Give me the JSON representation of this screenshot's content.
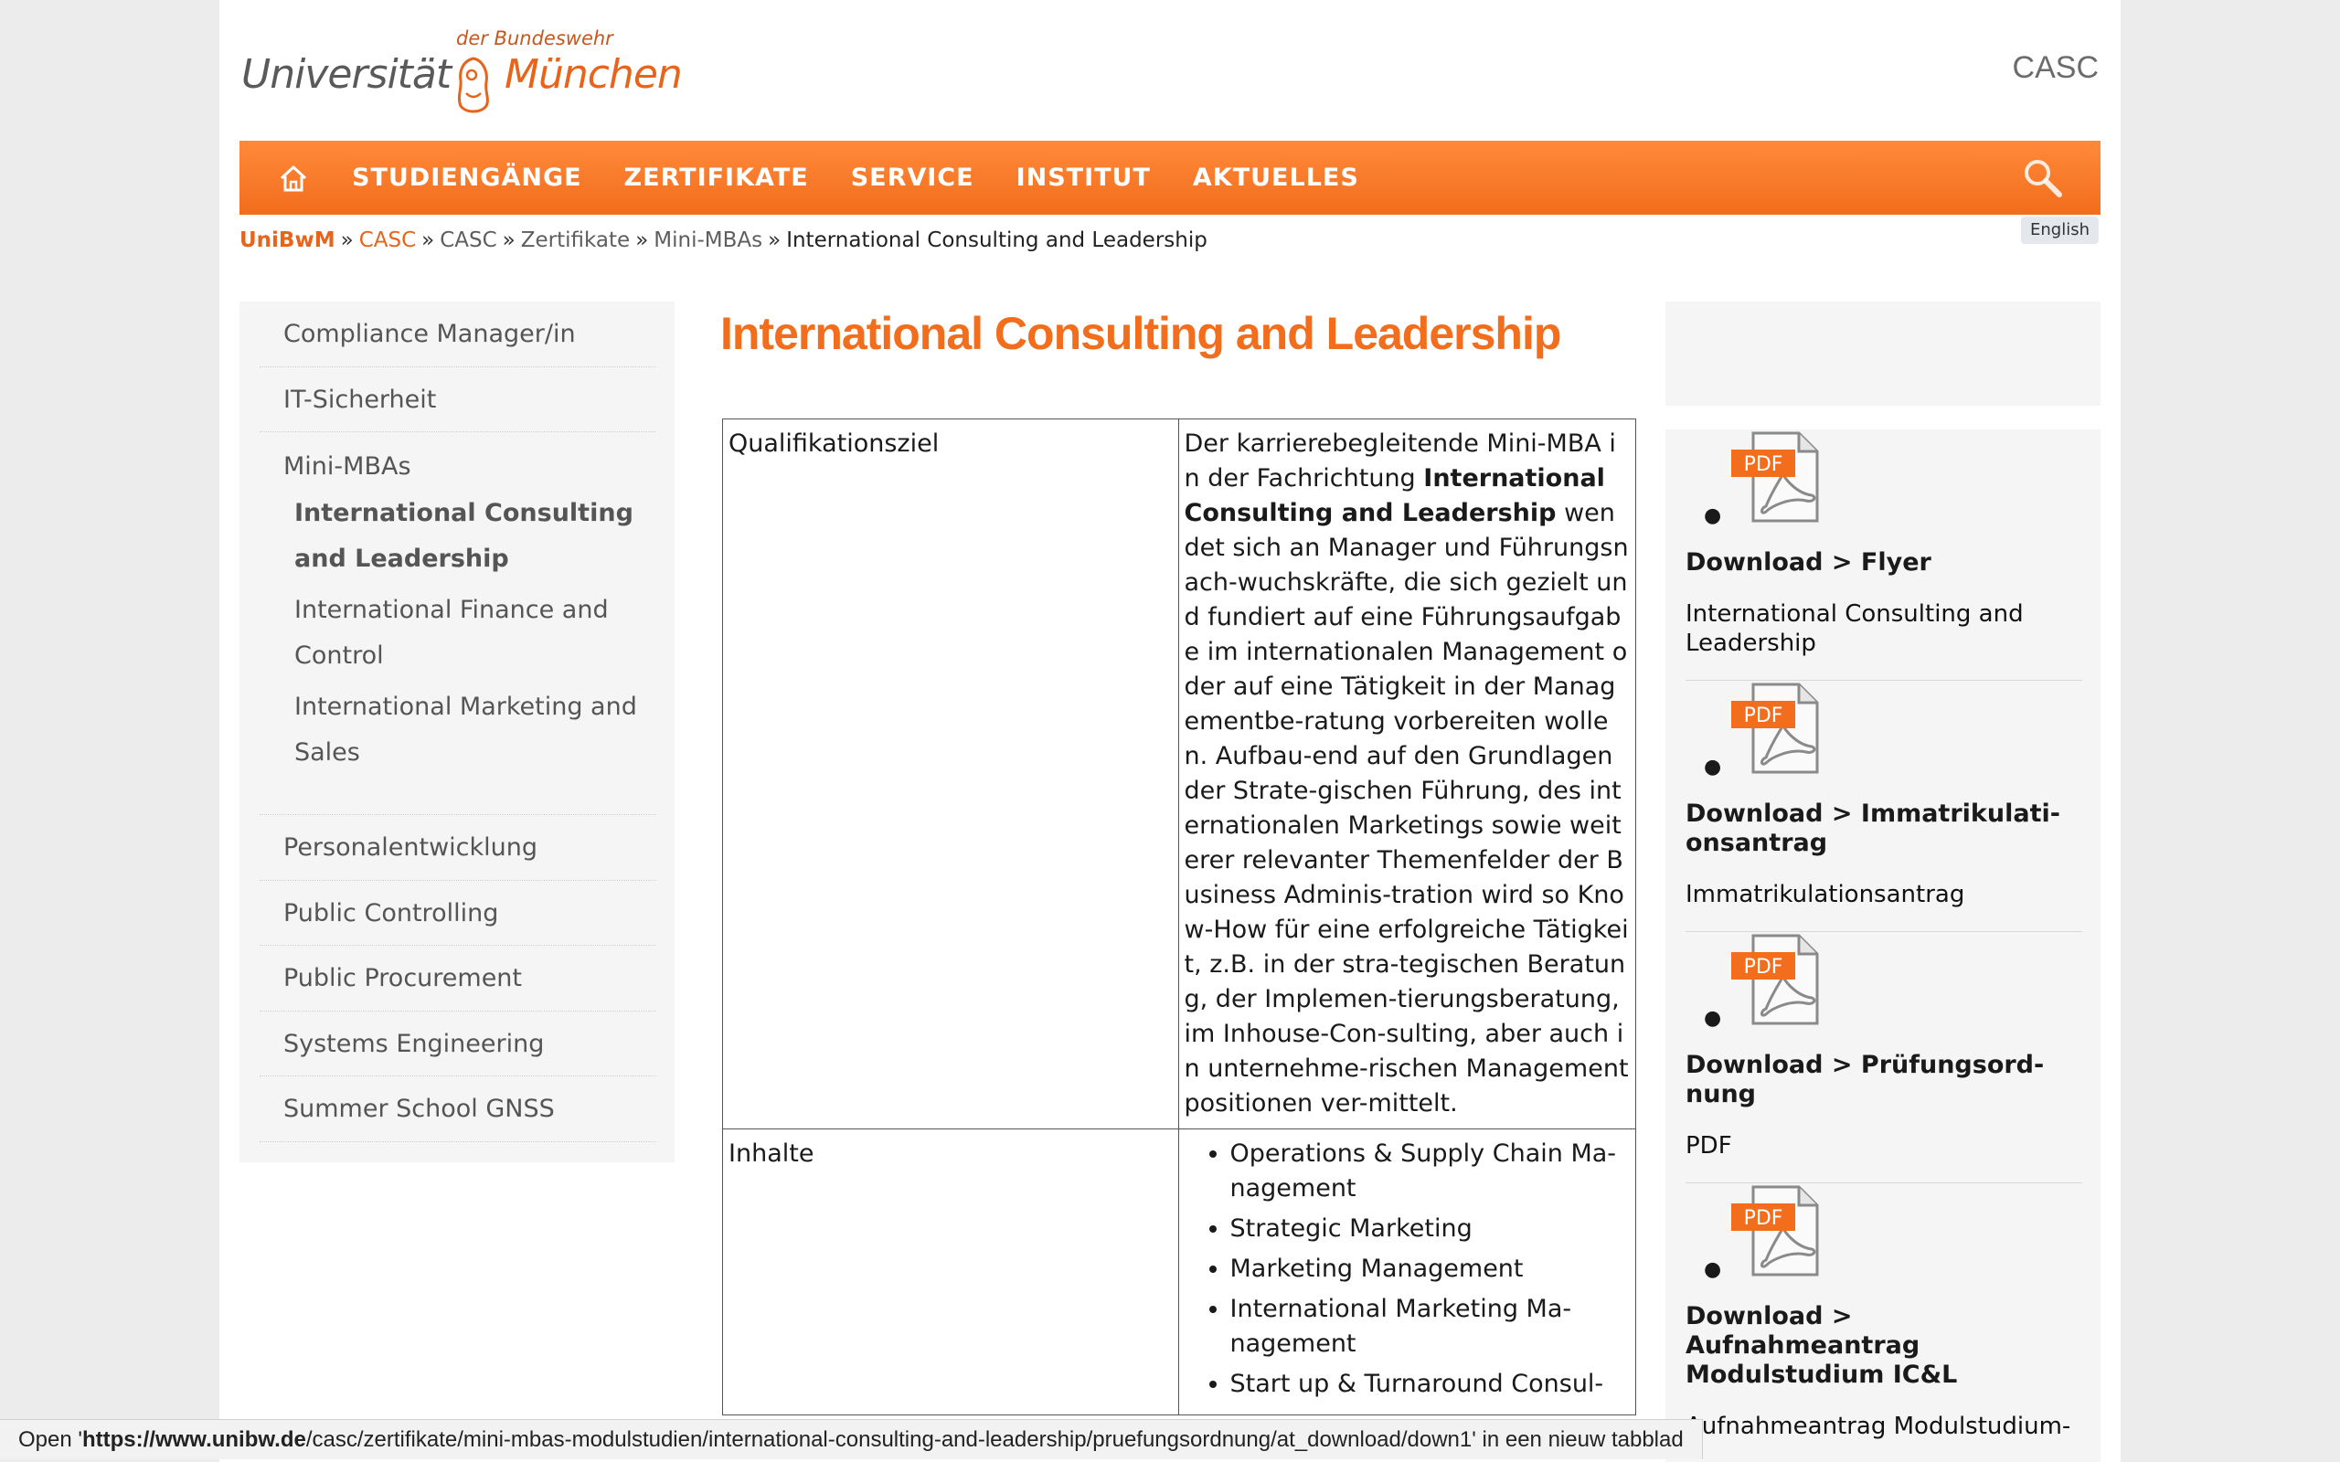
{
  "header": {
    "logo_small": "der Bundeswehr",
    "logo_left": "Universität",
    "logo_right": "München",
    "site_name": "CASC"
  },
  "nav": {
    "items": [
      "STUDIENGÄNGE",
      "ZERTIFIKATE",
      "SERVICE",
      "INSTITUT",
      "AKTUELLES"
    ]
  },
  "breadcrumb": {
    "items": [
      "UniBwM",
      "CASC",
      "CASC",
      "Zertifikate",
      "Mini-MBAs",
      "International Consulting and Leadership"
    ],
    "separator": "»"
  },
  "language_button": "English",
  "sidebar": {
    "items_top": [
      "Compliance Manager/in",
      "IT-Sicherheit"
    ],
    "group": {
      "label": "Mini-MBAs",
      "subitems": [
        "International Consulting and Leadership",
        "International Finance and Control",
        "International Marketing and Sales"
      ]
    },
    "items_bottom": [
      "Personalentwicklung",
      "Public Controlling",
      "Public Procurement",
      "Systems Engineering",
      "Summer School GNSS"
    ]
  },
  "main": {
    "title": "International Consulting and Leadership",
    "table": {
      "row1_label": "Qualifikationsziel",
      "row1_text_pre": "Der karrierebegleitende Mini-MBA in der Fachrichtung ",
      "row1_text_bold": "International Consulting and Leadership",
      "row1_text_post": " wendet sich an Manager und Führungsnach-wuchskräfte, die sich gezielt und fundiert auf eine Führungsaufgabe im internationalen Management oder auf eine Tätigkeit in der Managementbe-ratung vorbereiten wollen. Aufbau-end auf den Grundlagen der Strate-gischen Führung, des internationalen Marketings sowie weiterer relevanter Themenfelder der Business Adminis-tration wird so Know-How für eine erfolgreiche Tätigkeit, z.B. in der stra-tegischen Beratung, der Implemen-tierungsberatung, im Inhouse-Con-sulting, aber auch in unternehme-rischen Managementpositionen ver-mittelt.",
      "row2_label": "Inhalte",
      "row2_items": [
        "Operations & Supply Chain Ma-nagement",
        "Strategic Marketing",
        "Marketing Management",
        "International Marketing Ma-nagement",
        "Start up & Turnaround Consul-"
      ]
    }
  },
  "downloads": [
    {
      "icon": "pdf-icon",
      "icon_label": "PDF",
      "title": "Download > Flyer",
      "desc": "International Consulting and Leadership"
    },
    {
      "icon": "pdf-icon",
      "icon_label": "PDF",
      "title": "Download > Immatrikulati-onsantrag",
      "desc": "Immatrikulationsantrag"
    },
    {
      "icon": "pdf-icon",
      "icon_label": "PDF",
      "title": "Download > Prüfungsord-nung",
      "desc": "PDF"
    },
    {
      "icon": "pdf-icon",
      "icon_label": "PDF",
      "title": "Download > Aufnahmeantrag Modulstudium IC&L",
      "desc": "Aufnahmeantrag Modulstudium-"
    }
  ],
  "status_bar": {
    "pre": "Open '",
    "url_bold": "https://www.unibw.de",
    "url_rest": "/casc/zertifikate/mini-mbas-modulstudien/international-consulting-and-leadership/pruefungsordnung/at_download/down1",
    "post": "' in een nieuw tabblad"
  },
  "colors": {
    "accent": "#f26d1c",
    "nav_top": "#ff8a3a",
    "sidebar_bg": "#f5f5f5",
    "page_bg": "#ececec"
  }
}
